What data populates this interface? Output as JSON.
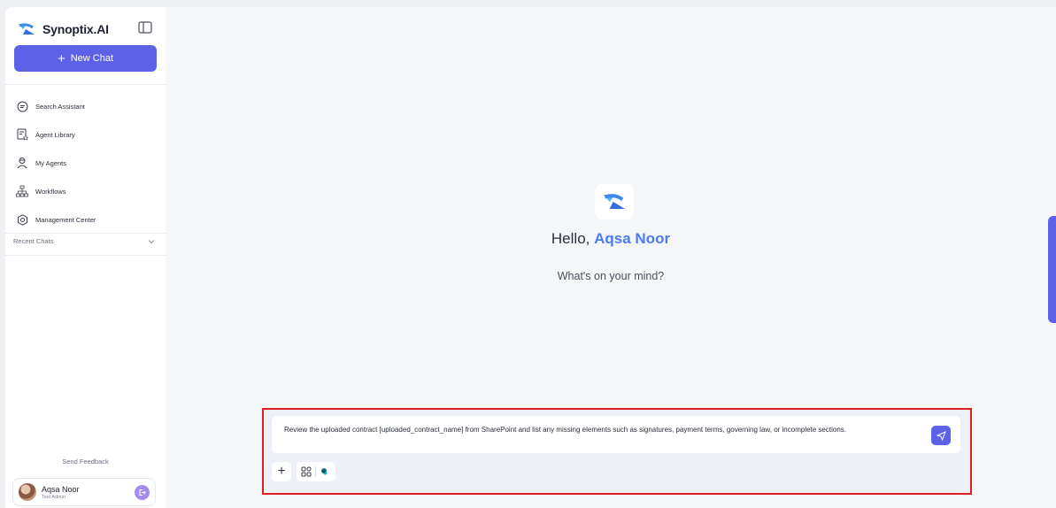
{
  "brand": {
    "name": "Synoptix.AI",
    "accent": "#5b62e8"
  },
  "sidebar": {
    "new_chat_label": "New Chat",
    "items": [
      {
        "label": "Search Assistant",
        "icon": "chat-icon"
      },
      {
        "label": "Agent Library",
        "icon": "document-star-icon"
      },
      {
        "label": "My Agents",
        "icon": "agent-icon"
      },
      {
        "label": "Workflows",
        "icon": "workflow-icon"
      },
      {
        "label": "Management Center",
        "icon": "gear-icon"
      }
    ],
    "recent_chats_label": "Recent Chats",
    "send_feedback_label": "Send Feedback",
    "user": {
      "name": "Aqsa Noor",
      "role": "Test Admin"
    }
  },
  "main": {
    "greeting_prefix": "Hello,",
    "greeting_name": "Aqsa Noor",
    "subtitle": "What's on your mind?",
    "composer": {
      "text": "Review the uploaded contract [uploaded_contract_name] from SharePoint and list any missing elements such as signatures, payment terms, governing law, or incomplete sections."
    }
  }
}
